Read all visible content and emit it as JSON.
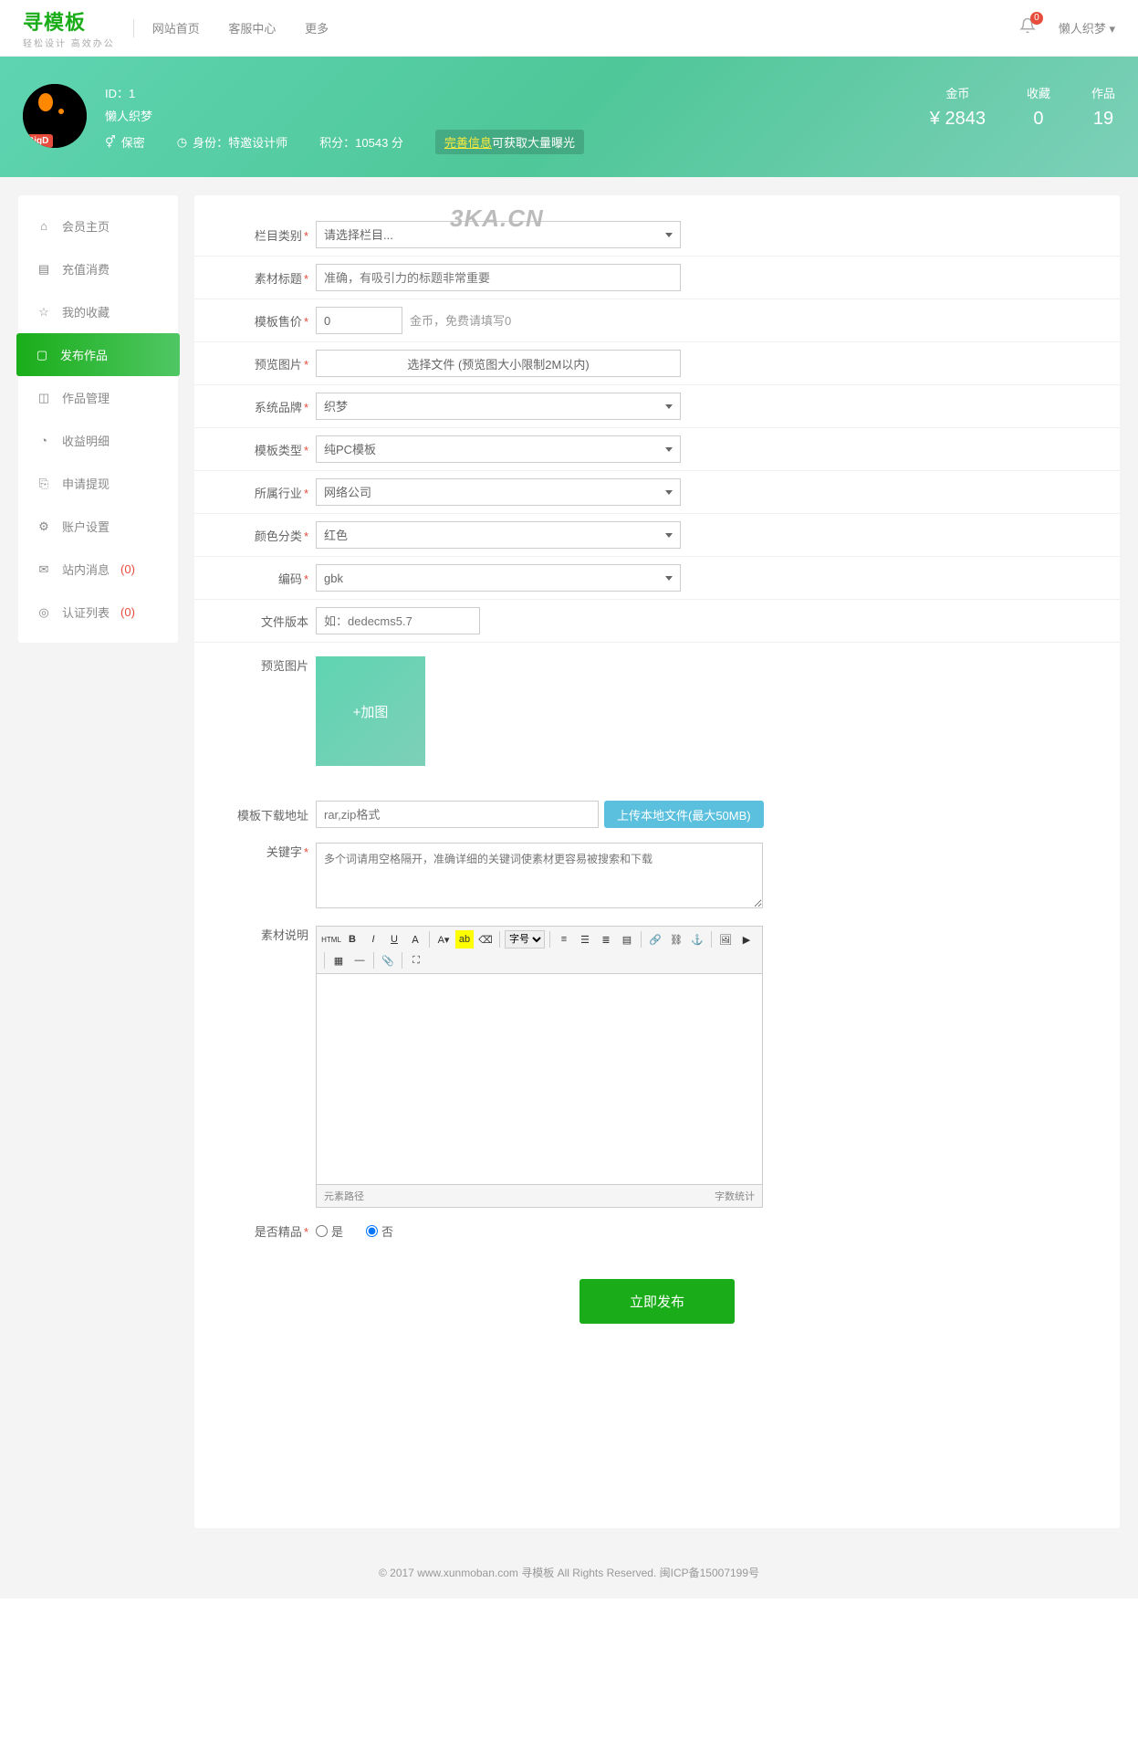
{
  "header": {
    "logo": "寻模板",
    "logo_sub": "轻松设计 高效办公",
    "nav": {
      "home": "网站首页",
      "service": "客服中心",
      "more": "更多"
    },
    "bell_count": "0",
    "username": "懒人织梦"
  },
  "banner": {
    "avatar_badge": "BigD",
    "id_label": "ID：1",
    "nickname": "懒人织梦",
    "security": "保密",
    "identity_label": "身份：",
    "identity_value": "特邀设计师",
    "score_label": "积分：",
    "score_value": "10543 分",
    "perfect_link": "完善信息",
    "perfect_suffix": "可获取大量曝光",
    "stats": {
      "gold_label": "金币",
      "gold_value": "¥ 2843",
      "fav_label": "收藏",
      "fav_value": "0",
      "work_label": "作品",
      "work_value": "19"
    }
  },
  "sidebar": {
    "items": [
      {
        "label": "会员主页"
      },
      {
        "label": "充值消费"
      },
      {
        "label": "我的收藏"
      },
      {
        "label": "发布作品"
      },
      {
        "label": "作品管理"
      },
      {
        "label": "收益明细"
      },
      {
        "label": "申请提现"
      },
      {
        "label": "账户设置"
      },
      {
        "label": "站内消息",
        "count": "(0)"
      },
      {
        "label": "认证列表",
        "count": "(0)"
      }
    ]
  },
  "watermark": "3KA.CN",
  "form": {
    "category": {
      "label": "栏目类别",
      "placeholder": "请选择栏目..."
    },
    "title": {
      "label": "素材标题",
      "placeholder": "准确，有吸引力的标题非常重要"
    },
    "price": {
      "label": "模板售价",
      "value": "0",
      "hint": "金币，免费请填写0"
    },
    "preview_file": {
      "label": "预览图片",
      "btn": "选择文件 (预览图大小限制2M以内)"
    },
    "brand": {
      "label": "系统品牌",
      "value": "织梦"
    },
    "tpl_type": {
      "label": "模板类型",
      "value": "纯PC模板"
    },
    "industry": {
      "label": "所属行业",
      "value": "网络公司"
    },
    "color": {
      "label": "颜色分类",
      "value": "红色"
    },
    "encoding": {
      "label": "编码",
      "value": "gbk"
    },
    "file_ver": {
      "label": "文件版本",
      "placeholder": "如：dedecms5.7"
    },
    "preview_imgs": {
      "label": "预览图片",
      "add": "+加图"
    },
    "download": {
      "label": "模板下载地址",
      "placeholder": "rar,zip格式",
      "upload_btn": "上传本地文件(最大50MB)"
    },
    "keywords": {
      "label": "关键字",
      "placeholder": "多个词请用空格隔开，准确详细的关键词使素材更容易被搜索和下载"
    },
    "desc": {
      "label": "素材说明",
      "font_label": "字号",
      "foot_left": "元素路径",
      "foot_right": "字数统计"
    },
    "featured": {
      "label": "是否精品",
      "yes": "是",
      "no": "否"
    },
    "submit": "立即发布"
  },
  "footer": "© 2017 www.xunmoban.com 寻模板 All Rights Reserved. 闽ICP备15007199号"
}
